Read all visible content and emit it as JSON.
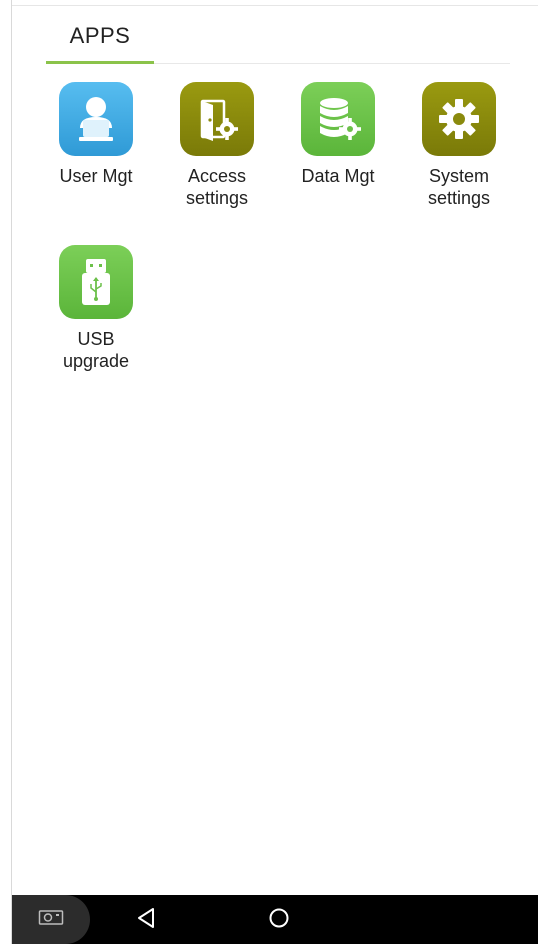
{
  "header": {
    "tab_label": "APPS"
  },
  "apps": [
    {
      "label": "User Mgt",
      "icon": "user-icon",
      "color": "#3aa5e0"
    },
    {
      "label": "Access\nsettings",
      "icon": "door-gear-icon",
      "color": "#8a8a0d"
    },
    {
      "label": "Data Mgt",
      "icon": "database-gear-icon",
      "color": "#6cc04a"
    },
    {
      "label": "System\nsettings",
      "icon": "gear-icon",
      "color": "#8a8a0d"
    },
    {
      "label": "USB\nupgrade",
      "icon": "usb-drive-icon",
      "color": "#6cc04a"
    }
  ],
  "navbar": {
    "icons": [
      "screenshot-icon",
      "back-icon",
      "home-icon"
    ]
  },
  "colors": {
    "accent": "#8bc34a",
    "navbar": "#000000"
  }
}
